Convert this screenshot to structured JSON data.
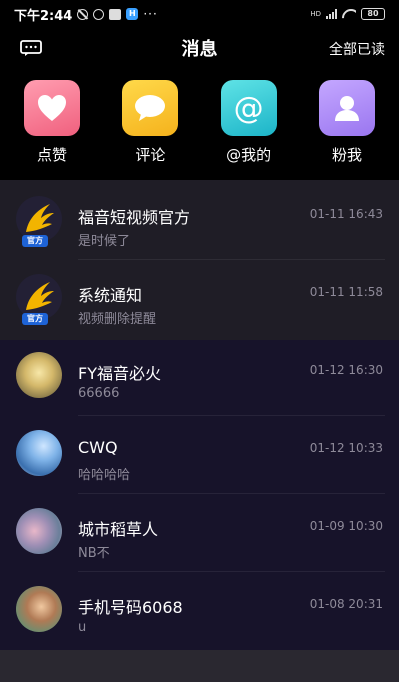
{
  "status_bar": {
    "time": "下午2:44",
    "app_badge": "H",
    "more_dots": "···",
    "signal_label": "HD",
    "battery": "80"
  },
  "header": {
    "title": "消息",
    "read_all": "全部已读"
  },
  "quick_actions": [
    {
      "label": "点赞",
      "icon": "heart-icon",
      "color": "#f0607e"
    },
    {
      "label": "评论",
      "icon": "comment-icon",
      "color": "#f5b21c"
    },
    {
      "label": "@我的",
      "icon": "at-icon",
      "glyph": "@",
      "color": "#1cb4c8"
    },
    {
      "label": "粉我",
      "icon": "person-icon",
      "color": "#9a76f0"
    }
  ],
  "messages": [
    {
      "name": "福音短视频官方",
      "preview": "是时候了",
      "time": "01-11 16:43",
      "official": true,
      "badge": "官方"
    },
    {
      "name": "系统通知",
      "preview": "视频删除提醒",
      "time": "01-11 11:58",
      "official": true,
      "badge": "官方"
    },
    {
      "name": "FY福音必火",
      "preview": "66666",
      "time": "01-12 16:30",
      "official": false
    },
    {
      "name": "CWQ",
      "preview": "哈哈哈哈",
      "time": "01-12 10:33",
      "official": false
    },
    {
      "name": "城市稻草人",
      "preview": "NB不",
      "time": "01-09 10:30",
      "official": false
    },
    {
      "name": "手机号码6068",
      "preview": "u",
      "time": "01-08 20:31",
      "official": false
    }
  ]
}
